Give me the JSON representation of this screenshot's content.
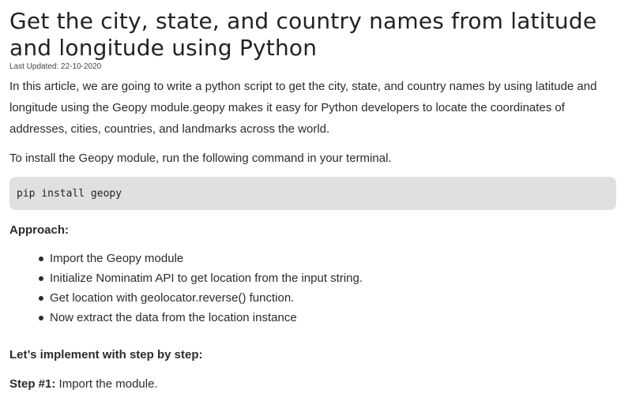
{
  "article": {
    "title": "Get the city, state, and country names from latitude and longitude using Python",
    "last_updated": "Last Updated: 22-10-2020",
    "intro": "In this article, we are going to write a python script to get the city, state, and country names by using latitude and longitude using the Geopy module.geopy makes it easy for Python developers to locate the coordinates of addresses, cities, countries, and landmarks across the world.",
    "install_text": "To install the Geopy module, run the following command in your terminal.",
    "install_command": "pip install geopy",
    "approach_heading": "Approach:",
    "approach_steps": [
      "Import the Geopy module",
      "Initialize Nominatim API to get location from the input string.",
      "Get location with geolocator.reverse() function.",
      "Now extract the data from the location instance"
    ],
    "implement_heading": "Let’s implement with step by step:",
    "step1_label": "Step #1:",
    "step1_text": "Import the module."
  },
  "colors": {
    "code_background": "#e0e0e0",
    "text": "#2b2b2b"
  }
}
